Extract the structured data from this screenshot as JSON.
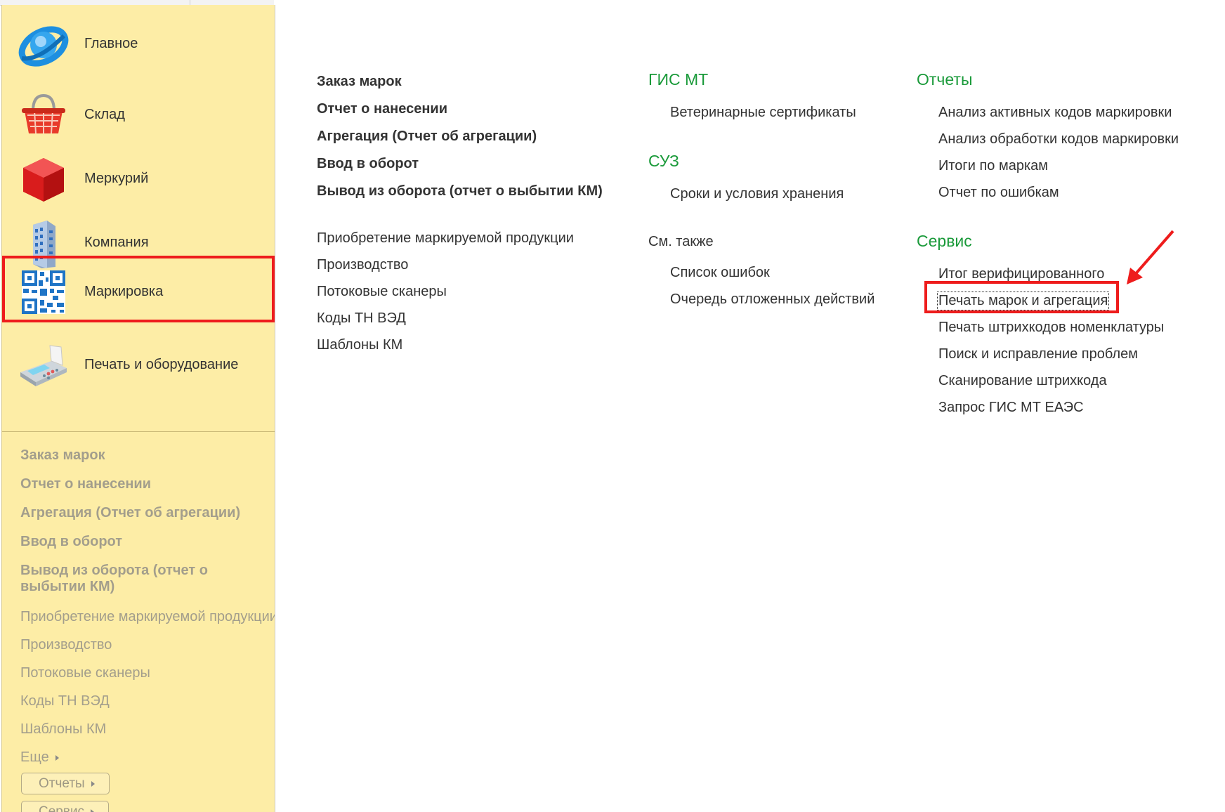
{
  "sections": [
    {
      "label": "Главное",
      "icon": "globe-icon"
    },
    {
      "label": "Склад",
      "icon": "basket-icon"
    },
    {
      "label": "Меркурий",
      "icon": "red-cube-icon"
    },
    {
      "label": "Компания",
      "icon": "office-building-icon"
    },
    {
      "label": "Маркировка",
      "icon": "qr-code-icon",
      "active": true
    },
    {
      "label": "Печать и оборудование",
      "icon": "pos-terminal-icon"
    }
  ],
  "sidebar_links": {
    "bold": [
      "Заказ марок",
      "Отчет о нанесении",
      "Агрегация (Отчет об агрегации)",
      "Ввод в оборот",
      "Вывод из оборота (отчет о",
      "выбытии КМ)"
    ],
    "regular": [
      "Приобретение маркируемой продукции",
      "Производство",
      "Потоковые сканеры",
      "Коды ТН ВЭД",
      "Шаблоны КМ"
    ],
    "more": "Еще",
    "reports_button": "Отчеты",
    "service_button": "Сервис"
  },
  "main": {
    "col1_bold": [
      "Заказ марок",
      "Отчет о нанесении",
      "Агрегация (Отчет об агрегации)",
      "Ввод в оборот",
      "Вывод из оборота (отчет о выбытии КМ)"
    ],
    "col1_regular": [
      "Приобретение маркируемой продукции",
      "Производство",
      "Потоковые сканеры",
      "Коды ТН ВЭД",
      "Шаблоны КМ"
    ],
    "gis_header": "ГИС МТ",
    "gis_items": [
      "Ветеринарные сертификаты"
    ],
    "suz_header": "СУЗ",
    "suz_items": [
      "Сроки и условия хранения"
    ],
    "see_also": "См. также",
    "see_also_items": [
      "Список ошибок",
      "Очередь отложенных действий"
    ],
    "reports_header": "Отчеты",
    "reports_items": [
      "Анализ активных кодов маркировки",
      "Анализ обработки кодов маркировки",
      "Итоги по маркам",
      "Отчет по ошибкам"
    ],
    "service_header": "Сервис",
    "service_items": [
      "Итог верифицированного",
      "Печать марок и агрегация",
      "Печать штрихкодов номенклатуры",
      "Поиск и исправление проблем",
      "Сканирование штрихкода",
      "Запрос ГИС МТ ЕАЭС"
    ]
  },
  "colors": {
    "sidebar_bg": "#fdeda6",
    "header_green": "#1a9a3a",
    "highlight_red": "#ee1c1c",
    "sidebar_link_gray": "#a39e8c"
  }
}
